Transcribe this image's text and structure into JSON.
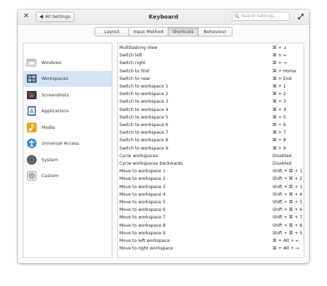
{
  "window": {
    "title": "Keyboard",
    "back_label": "All Settings",
    "search_placeholder": "Search Settings"
  },
  "tabs": [
    {
      "label": "Layout",
      "active": false
    },
    {
      "label": "Input Method",
      "active": false
    },
    {
      "label": "Shortcuts",
      "active": true
    },
    {
      "label": "Behaviour",
      "active": false
    }
  ],
  "sidebar": {
    "selected": "Workspaces",
    "items": [
      {
        "label": "Windows",
        "icon": "windows-icon"
      },
      {
        "label": "Workspaces",
        "icon": "workspaces-icon"
      },
      {
        "label": "Screenshots",
        "icon": "screenshots-icon"
      },
      {
        "label": "Applications",
        "icon": "applications-icon"
      },
      {
        "label": "Media",
        "icon": "media-icon"
      },
      {
        "label": "Universal Access",
        "icon": "universal-access-icon"
      },
      {
        "label": "System",
        "icon": "system-icon"
      },
      {
        "label": "Custom",
        "icon": "custom-icon"
      }
    ]
  },
  "shortcuts": [
    {
      "action": "Multitasking View",
      "accel": "⌘ + ↓"
    },
    {
      "action": "Switch left",
      "accel": "⌘ + ←"
    },
    {
      "action": "Switch right",
      "accel": "⌘ + →"
    },
    {
      "action": "Switch to first",
      "accel": "⌘ + Home"
    },
    {
      "action": "Switch to new",
      "accel": "⌘ + End"
    },
    {
      "action": "Switch to workspace 1",
      "accel": "⌘ + 1"
    },
    {
      "action": "Switch to workspace 2",
      "accel": "⌘ + 2"
    },
    {
      "action": "Switch to workspace 3",
      "accel": "⌘ + 3"
    },
    {
      "action": "Switch to workspace 4",
      "accel": "⌘ + 4"
    },
    {
      "action": "Switch to workspace 5",
      "accel": "⌘ + 5"
    },
    {
      "action": "Switch to workspace 6",
      "accel": "⌘ + 6"
    },
    {
      "action": "Switch to workspace 7",
      "accel": "⌘ + 7"
    },
    {
      "action": "Switch to workspace 8",
      "accel": "⌘ + 8"
    },
    {
      "action": "Switch to workspace 9",
      "accel": "⌘ + 9"
    },
    {
      "action": "Cycle workspaces",
      "accel": "Disabled"
    },
    {
      "action": "Cycle workspaces backwards",
      "accel": "Disabled"
    },
    {
      "action": "Move to workspace 1",
      "accel": "Shift + ⌘ + 1"
    },
    {
      "action": "Move to workspace 2",
      "accel": "Shift + ⌘ + 2"
    },
    {
      "action": "Move to workspace 3",
      "accel": "Shift + ⌘ + 3"
    },
    {
      "action": "Move to workspace 4",
      "accel": "Shift + ⌘ + 4"
    },
    {
      "action": "Move to workspace 5",
      "accel": "Shift + ⌘ + 5"
    },
    {
      "action": "Move to workspace 6",
      "accel": "Shift + ⌘ + 6"
    },
    {
      "action": "Move to workspace 7",
      "accel": "Shift + ⌘ + 7"
    },
    {
      "action": "Move to workspace 8",
      "accel": "Shift + ⌘ + 8"
    },
    {
      "action": "Move to workspace 9",
      "accel": "Shift + ⌘ + 9"
    },
    {
      "action": "Move to left workspace",
      "accel": "⌘ + Alt + ←"
    },
    {
      "action": "Move to right workspace",
      "accel": "⌘ + Alt + →"
    }
  ],
  "colors": {
    "selection": "#d5e4f5",
    "border": "#cfcfcf"
  }
}
